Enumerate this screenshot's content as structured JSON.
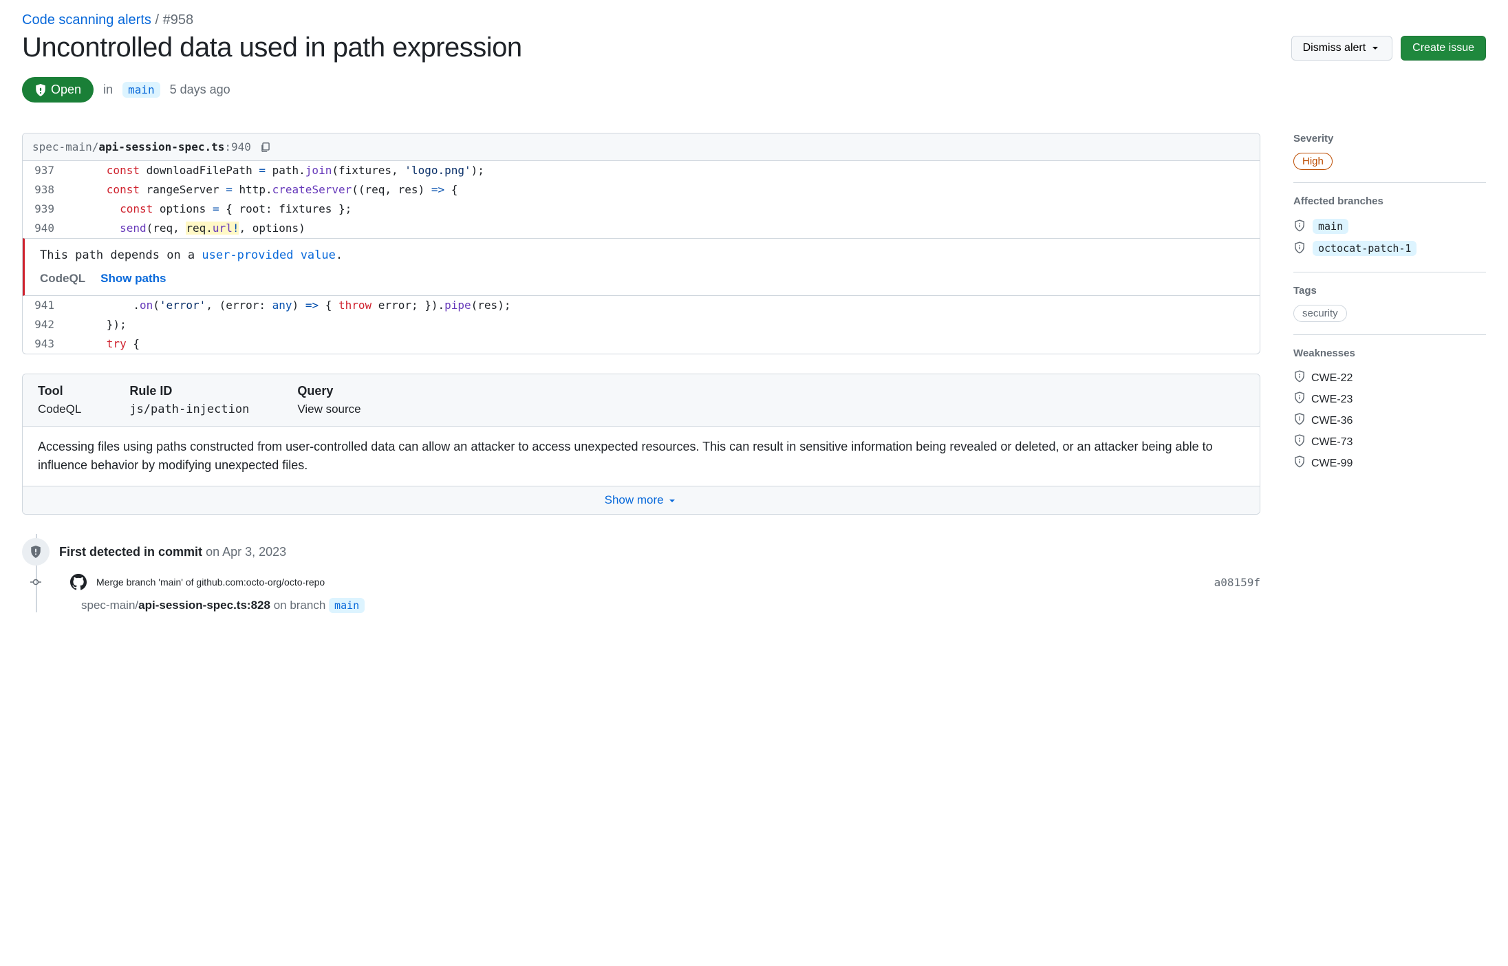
{
  "breadcrumb": {
    "parent": "Code scanning alerts",
    "sep": "/",
    "id": "#958"
  },
  "title": "Uncontrolled data used in path expression",
  "actions": {
    "dismiss": "Dismiss alert",
    "create_issue": "Create issue"
  },
  "status": {
    "state": "Open",
    "in": "in",
    "branch": "main",
    "age": "5 days ago"
  },
  "file": {
    "path_prefix": "spec-main/",
    "path_name": "api-session-spec.ts",
    "line_sep": ":",
    "line": "940"
  },
  "code": {
    "lines": [
      {
        "n": "937",
        "html": "      <span class='tok-kw'>const</span> downloadFilePath <span class='tok-op'>=</span> path.<span class='tok-fn'>join</span>(fixtures, <span class='tok-str'>'logo.png'</span>);"
      },
      {
        "n": "938",
        "html": "      <span class='tok-kw'>const</span> rangeServer <span class='tok-op'>=</span> http.<span class='tok-fn'>createServer</span>((req, res) <span class='tok-op'>=&gt;</span> {"
      },
      {
        "n": "939",
        "html": "        <span class='tok-kw'>const</span> options <span class='tok-op'>=</span> { root: fixtures };"
      },
      {
        "n": "940",
        "html": "        <span class='tok-fn'>send</span>(req, <span class='hl'>req.<span class='tok-fn'>url</span><span class='tok-op'>!</span></span>, options)"
      }
    ],
    "annotation": {
      "pre": "This path depends on a ",
      "link": "user-provided value",
      "post": ".",
      "tool": "CodeQL",
      "show_paths": "Show paths"
    },
    "lines_after": [
      {
        "n": "941",
        "html": "          .<span class='tok-fn'>on</span>(<span class='tok-str'>'error'</span>, (error: <span class='tok-op'>any</span>) <span class='tok-op'>=&gt;</span> { <span class='tok-kw'>throw</span> error; }).<span class='tok-fn'>pipe</span>(res);"
      },
      {
        "n": "942",
        "html": "      });"
      },
      {
        "n": "943",
        "html": "      <span class='tok-kw'>try</span> {"
      }
    ]
  },
  "info": {
    "tool_label": "Tool",
    "tool_val": "CodeQL",
    "rule_label": "Rule ID",
    "rule_val": "js/path-injection",
    "query_label": "Query",
    "query_val": "View source",
    "description": "Accessing files using paths constructed from user-controlled data can allow an attacker to access unexpected resources. This can result in sensitive information being revealed or deleted, or an attacker being able to influence behavior by modifying unexpected files.",
    "show_more": "Show more"
  },
  "timeline": {
    "title_prefix": "First detected in commit",
    "title_date": "on Apr 3, 2023",
    "commit_msg": "Merge branch 'main' of github.com:octo-org/octo-repo",
    "commit_hash": "a08159f",
    "file_prefix": "spec-main/",
    "file_name": "api-session-spec.ts:828",
    "on_branch": "on branch",
    "branch": "main"
  },
  "side": {
    "severity_label": "Severity",
    "severity": "High",
    "branches_label": "Affected branches",
    "branches": [
      "main",
      "octocat-patch-1"
    ],
    "tags_label": "Tags",
    "tags": [
      "security"
    ],
    "weak_label": "Weaknesses",
    "weaknesses": [
      "CWE-22",
      "CWE-23",
      "CWE-36",
      "CWE-73",
      "CWE-99"
    ]
  }
}
